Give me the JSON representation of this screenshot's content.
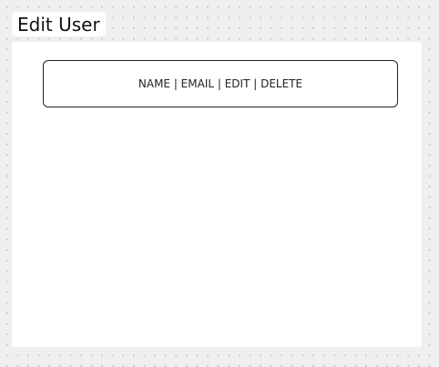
{
  "page": {
    "title": "Edit User"
  },
  "table": {
    "header_text": "NAME | EMAIL | EDIT | DELETE"
  }
}
